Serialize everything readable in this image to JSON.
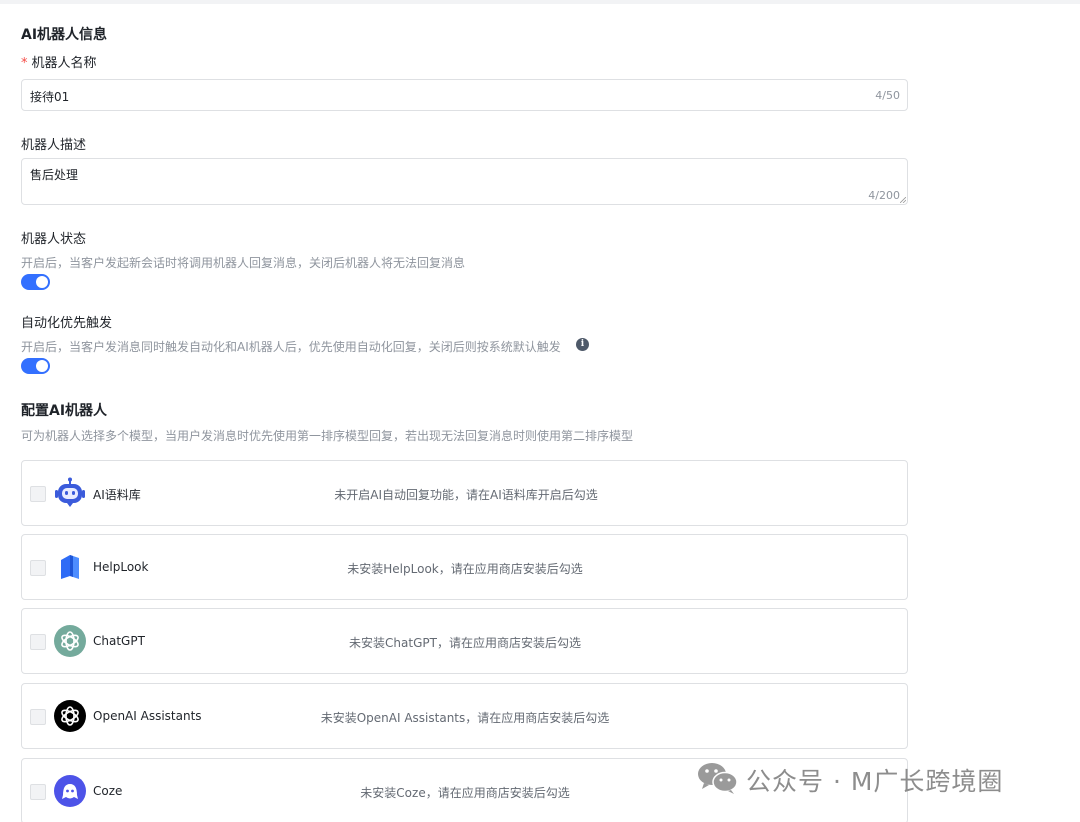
{
  "section_info": {
    "title": "AI机器人信息",
    "name_label": "机器人名称",
    "required_mark": "*",
    "name_value": "接待01",
    "name_counter": "4/50",
    "desc_label": "机器人描述",
    "desc_value": "售后处理",
    "desc_counter": "4/200"
  },
  "status": {
    "label": "机器人状态",
    "help": "开启后，当客户发起新会话时将调用机器人回复消息，关闭后机器人将无法回复消息",
    "enabled": true
  },
  "automation": {
    "label": "自动化优先触发",
    "help": "开启后，当客户发消息同时触发自动化和AI机器人后，优先使用自动化回复，关闭后则按系统默认触发",
    "enabled": true,
    "info_icon": "info-icon"
  },
  "config": {
    "title": "配置AI机器人",
    "help": "可为机器人选择多个模型，当用户发消息时优先使用第一排序模型回复，若出现无法回复消息时则使用第二排序模型"
  },
  "models": [
    {
      "name": "AI语料库",
      "status": "未开启AI自动回复功能，请在AI语料库开启后勾选",
      "icon": "robot-icon",
      "checked": false
    },
    {
      "name": "HelpLook",
      "status": "未安装HelpLook，请在应用商店安装后勾选",
      "icon": "helplook-icon",
      "checked": false
    },
    {
      "name": "ChatGPT",
      "status": "未安装ChatGPT，请在应用商店安装后勾选",
      "icon": "chatgpt-icon",
      "checked": false
    },
    {
      "name": "OpenAI Assistants",
      "status": "未安装OpenAI Assistants，请在应用商店安装后勾选",
      "icon": "openai-icon",
      "checked": false
    },
    {
      "name": "Coze",
      "status": "未安装Coze，请在应用商店安装后勾选",
      "icon": "coze-icon",
      "checked": false
    }
  ],
  "watermark": {
    "text": "公众号 · M广长跨境圈",
    "icon": "wechat-icon"
  },
  "colors": {
    "accent": "#3370ff",
    "border": "#dee0e3",
    "muted": "#8f959e"
  }
}
